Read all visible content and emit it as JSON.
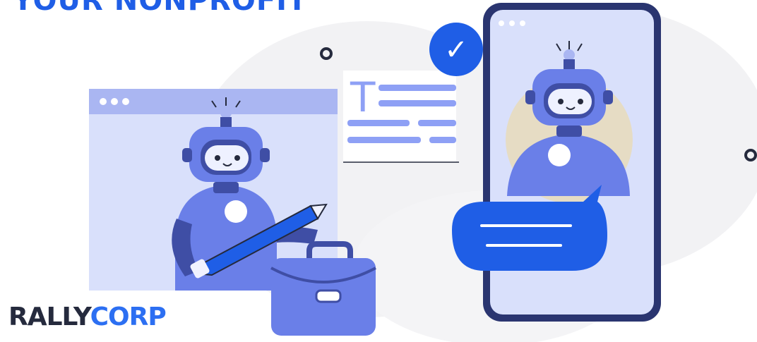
{
  "headline": "YOUR NONPROFIT",
  "brand": {
    "part1": "RALLY",
    "part2": "CORP"
  },
  "document_card": {
    "glyph": "T"
  },
  "checkmark": {
    "glyph": "✓"
  },
  "colors": {
    "primary_blue": "#1f5ee6",
    "brand_dark": "#252a3d",
    "brand_blue": "#2c6ff2",
    "robot_body": "#6a7fe8",
    "robot_dark": "#3f4ea5",
    "window_bg": "#d9e0fb",
    "window_bar": "#aab6f2"
  }
}
